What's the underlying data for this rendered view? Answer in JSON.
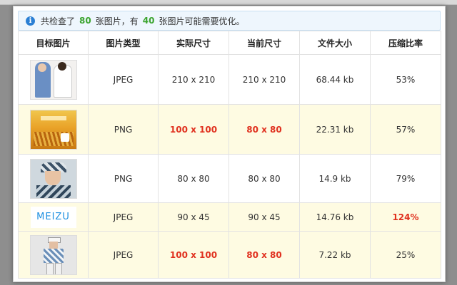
{
  "notice": {
    "prefix": "共检查了",
    "checked_count": "80",
    "middle": "张图片，有",
    "optimizable_count": "40",
    "suffix": "张图片可能需要优化。"
  },
  "table": {
    "headers": [
      "目标图片",
      "图片类型",
      "实际尺寸",
      "当前尺寸",
      "文件大小",
      "压缩比率"
    ],
    "rows": [
      {
        "type": "JPEG",
        "actual": "210 x 210",
        "current": "210 x 210",
        "size": "68.44 kb",
        "ratio": "53%"
      },
      {
        "type": "PNG",
        "actual": "100 x 100",
        "current": "80 x 80",
        "size": "22.31 kb",
        "ratio": "57%"
      },
      {
        "type": "PNG",
        "actual": "80 x 80",
        "current": "80 x 80",
        "size": "14.9 kb",
        "ratio": "79%"
      },
      {
        "type": "JPEG",
        "actual": "90 x 45",
        "current": "90 x 45",
        "size": "14.76 kb",
        "ratio": "124%"
      },
      {
        "type": "JPEG",
        "actual": "100 x 100",
        "current": "80 x 80",
        "size": "7.22 kb",
        "ratio": "25%"
      }
    ],
    "thumb4_logo": "MEIZU"
  },
  "colors": {
    "highlight_green": "#3ba42f",
    "warning_red": "#e0301e",
    "alt_row": "#fefbe2",
    "info_blue": "#2a7fd4"
  },
  "icons": {
    "notice": "info-icon"
  }
}
